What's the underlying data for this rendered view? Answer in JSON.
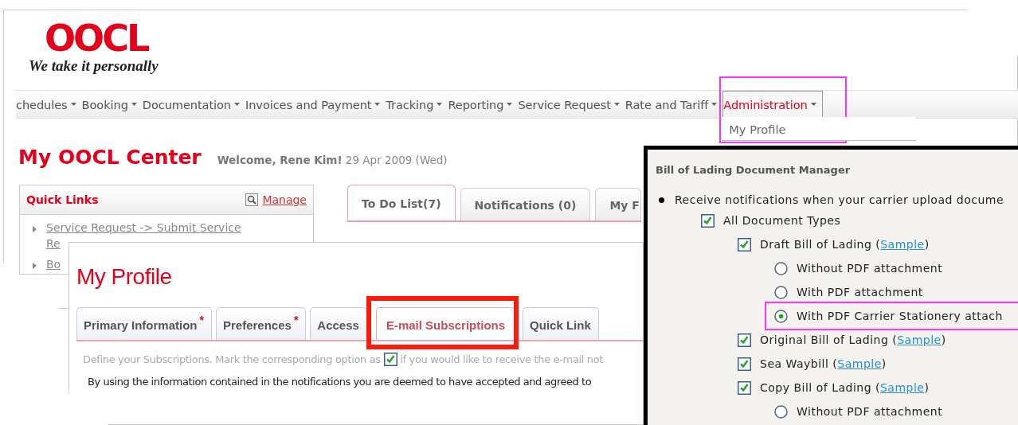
{
  "site": {
    "logo": "OOCL",
    "tagline": "We take it personally"
  },
  "nav": {
    "items": [
      {
        "label": "chedules",
        "open": false,
        "callout": false
      },
      {
        "label": "Booking",
        "open": false,
        "callout": false
      },
      {
        "label": "Documentation",
        "open": false,
        "callout": false
      },
      {
        "label": "Invoices and Payment",
        "open": false,
        "callout": false
      },
      {
        "label": "Tracking",
        "open": false,
        "callout": false
      },
      {
        "label": "Reporting",
        "open": false,
        "callout": false
      },
      {
        "label": "Service Request",
        "open": false,
        "callout": false
      },
      {
        "label": "Rate and Tariff",
        "open": false,
        "callout": false
      },
      {
        "label": "Administration",
        "open": true,
        "callout": true,
        "menu": [
          "My Profile"
        ]
      }
    ]
  },
  "center": {
    "title": "My OOCL Center",
    "welcome": "**Welcome, Rene Kim!** 29 Apr 2009 (Wed)"
  },
  "quick_links": {
    "title": "Quick Links",
    "manage": "Manage",
    "items": [
      {
        "lines": [
          "Service Request -> Submit Service",
          "Re"
        ]
      },
      {
        "lines": [
          "Bo"
        ]
      }
    ]
  },
  "center_tabs": [
    {
      "label": "To Do List(7)",
      "selected": true
    },
    {
      "label": "Notifications (0)",
      "selected": false
    },
    {
      "label": "My F",
      "selected": false
    }
  ],
  "profile": {
    "title": "My Profile",
    "tabs": [
      {
        "label": "Primary Information",
        "required_mark": "*",
        "selected": false,
        "callout": false
      },
      {
        "label": "Preferences",
        "required_mark": "*",
        "selected": false,
        "callout": false
      },
      {
        "label": "Access",
        "selected": false,
        "callout": false
      },
      {
        "label": "E-mail Subscriptions",
        "selected": true,
        "callout": true
      },
      {
        "label": "Quick Link",
        "selected": false,
        "callout": false
      }
    ],
    "description": {
      "before": "Define your Subscriptions. Mark the corresponding option as",
      "checked": true,
      "after": "if you would like to receive the e-mail not"
    },
    "disclaimer": "By using the information contained in the notifications you are deemed to have accepted and agreed to"
  },
  "document_manager": {
    "title": "Bill of Lading Document Manager",
    "bullet_text": "Receive notifications when your carrier upload docume",
    "options": [
      {
        "kind": "checkbox",
        "label": "All Document Types",
        "checked": true,
        "children": [
          {
            "kind": "checkbox",
            "label": "Draft Bill of Lading (",
            "link": "Sample",
            "label_end": ")",
            "checked": true,
            "children": [
              {
                "kind": "radio",
                "label": "Without PDF attachment",
                "selected": false,
                "callout": false
              },
              {
                "kind": "radio",
                "label": "With PDF attachment",
                "selected": false,
                "callout": false
              },
              {
                "kind": "radio",
                "label": "With PDF Carrier Stationery attach",
                "selected": true,
                "callout": true
              }
            ]
          },
          {
            "kind": "checkbox",
            "label": "Original Bill of Lading (",
            "link": "Sample",
            "label_end": ")",
            "checked": true
          },
          {
            "kind": "checkbox",
            "label": "Sea Waybill (",
            "link": "Sample",
            "label_end": ")",
            "checked": true
          },
          {
            "kind": "checkbox",
            "label": "Copy Bill of Lading (",
            "link": "Sample",
            "label_end": ")",
            "checked": true,
            "children": [
              {
                "kind": "radio",
                "label": "Without PDF attachment",
                "selected": false,
                "callout": false
              }
            ]
          }
        ]
      }
    ]
  }
}
